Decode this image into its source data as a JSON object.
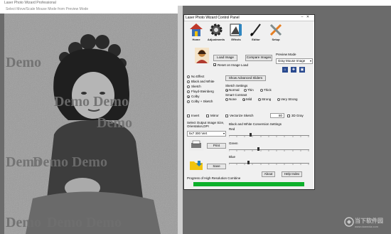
{
  "app": {
    "title": "Laser Photo Wizard Professional"
  },
  "preview": {
    "header": "Select Move/Scale Mouse Mode from Preview Mode",
    "watermark_word": "Demo"
  },
  "watermark": {
    "name": "当下软件园",
    "url": "www.downxia.com"
  },
  "panel": {
    "title": "Laser Photo Wizard Control Panel",
    "toolbar": [
      {
        "label": "Home",
        "icon": "home-icon"
      },
      {
        "label": "Adjustments",
        "icon": "gear-icon"
      },
      {
        "label": "Effects",
        "icon": "effects-icon"
      },
      {
        "label": "Editor",
        "icon": "brush-icon"
      },
      {
        "label": "Setup",
        "icon": "wrench-icon"
      }
    ],
    "load_image": "Load Image",
    "compare_images": "Compare Images",
    "preview_mode_label": "Preview Mode",
    "preview_mode_value": "Gray Mouse Image",
    "reset_on_load": "Reset on Image Load",
    "show_advanced": "Show Advanced Sliders",
    "effects": [
      "No Effect",
      "Black and White",
      "Sketch",
      "Floyd-Steinberg",
      "Colby",
      "Colby + Sketch"
    ],
    "selected_effect": "Colby",
    "sketch_settings_label": "Sketch Settings",
    "sketch_options": [
      "Normal",
      "Thin",
      "Thick"
    ],
    "smart_contrast_label": "Smart Contrast",
    "contrast_options": [
      "None",
      "Mild",
      "Strong",
      "Very Strong"
    ],
    "invert": "Invert",
    "mirror": "Mirror",
    "vectorize": "Vectorize Sketch",
    "gray_value": "80",
    "gray_label": "3D Gray",
    "output_size_label": "Select Output Image Size, Orientation,DPI",
    "output_size_value": "5x7 300 Vert",
    "bw_settings_label": "Black and White Conversion Settings",
    "red": "Red",
    "green": "Green",
    "blue": "Blue",
    "print": "Print",
    "save": "Save",
    "about": "About",
    "help": "Help Index",
    "progress_label": "Progress of High Resolution Combine",
    "progress_value": 1.0,
    "colors": {
      "progress": "#0db02b"
    }
  }
}
